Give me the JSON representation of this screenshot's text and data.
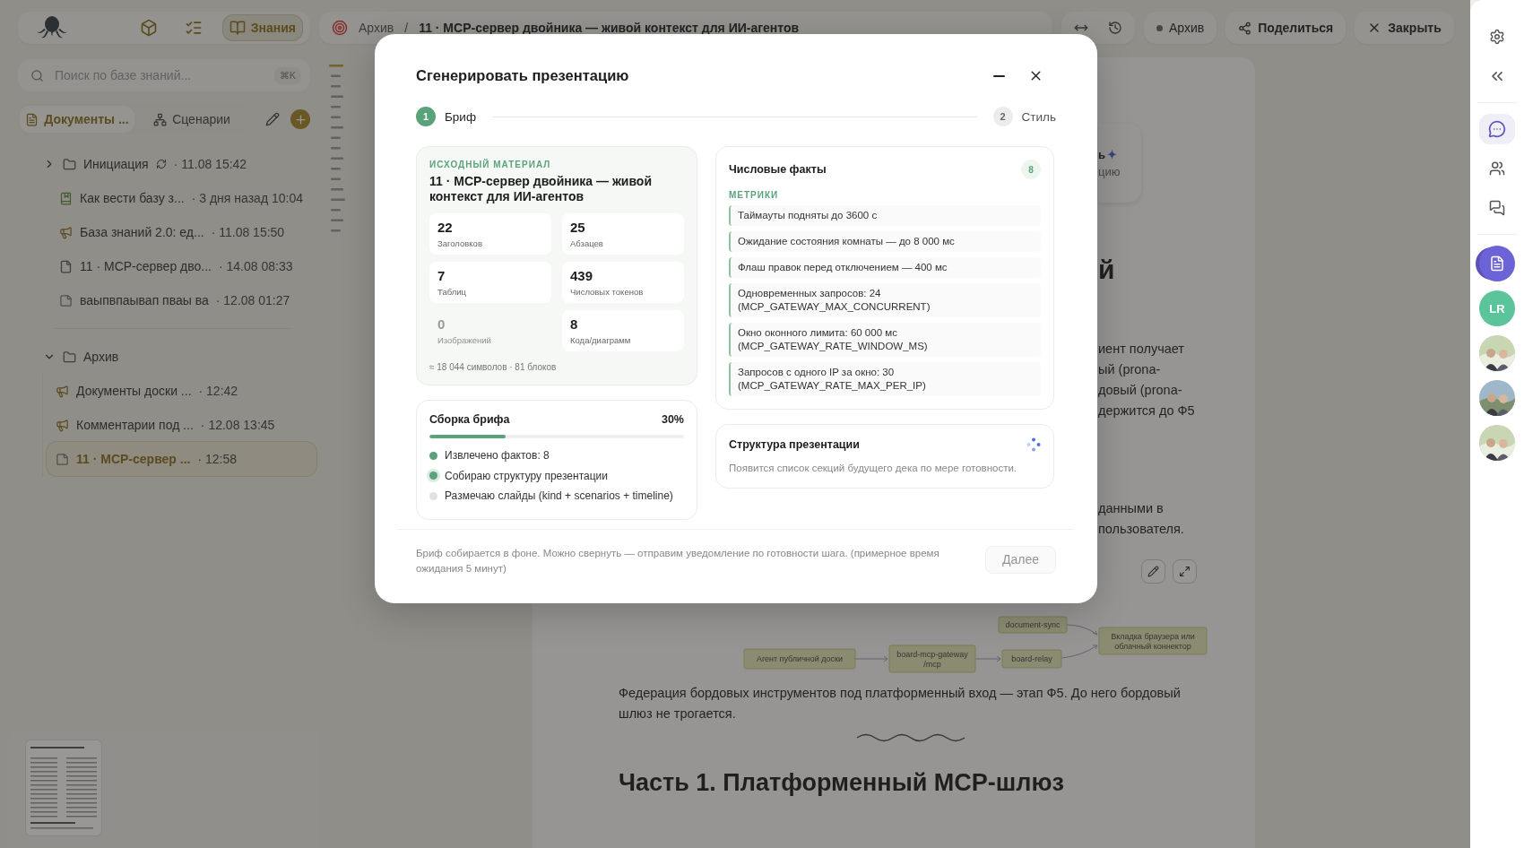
{
  "topbar": {
    "nav": [
      {
        "kind": "cube",
        "selected": false
      },
      {
        "kind": "checklist",
        "selected": false
      },
      {
        "kind": "book",
        "label": "Знания",
        "selected": true
      }
    ],
    "breadcrumb": {
      "parent": "Архив",
      "separator": "/",
      "current": "11 · MCP-сервер двойника — живой контекст для ИИ-агентов"
    },
    "status_button": {
      "label": "Архив"
    },
    "share_button": {
      "label": "Поделиться"
    },
    "close_button": {
      "label": "Закрыть"
    }
  },
  "sidebar": {
    "search": {
      "placeholder": "Поиск по базе знаний...",
      "shortcut": "⌘K"
    },
    "tabs": [
      {
        "kind": "page",
        "label": "Документы ...",
        "selected": true
      },
      {
        "kind": "flow",
        "label": "Сценарии",
        "selected": false
      }
    ],
    "tree_groups": [
      {
        "items": [
          {
            "kind": "folder",
            "title": "Инициация",
            "meta": "· 11.08 15:42",
            "expanded": false,
            "syncing": true,
            "selected": false
          },
          {
            "kind": "book",
            "title": "Как вести базу з...",
            "meta": "· 3 дня назад 10:04",
            "selected": false
          },
          {
            "kind": "megaphone",
            "title": "База знаний 2.0: ед...",
            "meta": "· 11.08 15:50",
            "selected": false
          },
          {
            "kind": "page",
            "title": "11 · MCP-сервер дво...",
            "meta": "· 14.08 08:33",
            "selected": false
          },
          {
            "kind": "board",
            "title": "ваыпвпаывап пваы ва",
            "meta": "· 12.08 01:27",
            "selected": false
          }
        ]
      },
      {
        "items": [
          {
            "kind": "folder",
            "title": "Архив",
            "expanded": true,
            "syncing": false,
            "selected": false,
            "children": [
              {
                "kind": "megaphone",
                "title": "Документы доски ...",
                "meta": "· 12:42",
                "selected": false
              },
              {
                "kind": "megaphone",
                "title": "Комментарии под ...",
                "meta": "· 12.08 13:45",
                "selected": false
              },
              {
                "kind": "board",
                "title": "11 · MCP-сервер ...",
                "meta": "· 12:58",
                "selected": true
              }
            ]
          }
        ]
      }
    ]
  },
  "document": {
    "card_fragment": [
      "ь",
      "цию"
    ],
    "card_sparkle": "✦",
    "heading_fragment": "й",
    "paragraph_fragment": [
      "иент получает",
      "ый (prona-",
      "довый (prona-",
      "держится до Ф5"
    ],
    "paragraph2_fragment": [
      "данными в",
      "пользователя."
    ],
    "diagram": {
      "nodes": [
        {
          "label": "document-sync"
        },
        {
          "label": "Вкладка браузера или облачный коннектор"
        },
        {
          "label": "Агент публичной доски"
        },
        {
          "label": "board-mcp-gateway /mcp"
        },
        {
          "label": "board-relay"
        }
      ]
    },
    "paragraph": "Федерация бордовых инструментов под платформенный вход — этап Ф5. До него бордовый шлюз не трогается.",
    "heading": "Часть 1. Платформенный MCP-шлюз"
  },
  "modal": {
    "title": "Сгенерировать презентацию",
    "steps": [
      {
        "number": "1",
        "label": "Бриф",
        "selected": true
      },
      {
        "number": "2",
        "label": "Стиль",
        "selected": false
      }
    ],
    "source": {
      "eyebrow": "ИСХОДНЫЙ МАТЕРИАЛ",
      "title": "11 · MCP-сервер двойника — живой контекст для ИИ-агентов",
      "stats": [
        {
          "value": "22",
          "label": "Заголовков",
          "disabled": false
        },
        {
          "value": "25",
          "label": "Абзацев",
          "disabled": false
        },
        {
          "value": "7",
          "label": "Таблиц",
          "disabled": false
        },
        {
          "value": "439",
          "label": "Числовых токенов",
          "disabled": false
        },
        {
          "value": "0",
          "label": "Изображений",
          "disabled": true
        },
        {
          "value": "8",
          "label": "Кода/диаграмм",
          "disabled": false
        }
      ],
      "summary": "≈ 18 044 символов · 81 блоков"
    },
    "progress": {
      "title": "Сборка брифа",
      "percent": "30%",
      "level": 0.3,
      "steps": [
        {
          "label": "Извлечено фактов: 8",
          "done": true,
          "active": false
        },
        {
          "label": "Собираю структуру презентации",
          "done": false,
          "active": true
        },
        {
          "label": "Размечаю слайды (kind + scenarios + timeline)",
          "done": false,
          "active": false
        }
      ]
    },
    "facts": {
      "title": "Числовые факты",
      "count": "8",
      "section": "МЕТРИКИ",
      "items": [
        "Таймауты подняты до 3600 с",
        "Ожидание состояния комнаты — до 8 000 мс",
        "Флаш правок перед отключением — 400 мс",
        "Одновременных запросов: 24 (MCP_GATEWAY_MAX_CONCURRENT)",
        "Окно оконного лимита: 60 000 мс (MCP_GATEWAY_RATE_WINDOW_MS)",
        "Запросов с одного IP за окно: 30 (MCP_GATEWAY_RATE_MAX_PER_IP)"
      ]
    },
    "structure": {
      "title": "Структура презентации",
      "text": "Появится список секций будущего дека по мере готовности."
    },
    "note": "Бриф собирается в фоне. Можно свернуть — отправим уведомление по готовности шага. (примерное время ожидания 5 минут)",
    "next_button": {
      "label": "Далее",
      "disabled": true
    }
  },
  "rail": {
    "tools": [
      {
        "kind": "chat",
        "selected": true
      },
      {
        "kind": "people",
        "selected": false
      },
      {
        "kind": "comments",
        "selected": false
      }
    ],
    "avatars": [
      {
        "kind": "document",
        "selected": true
      },
      {
        "kind": "initials",
        "initials": "LR",
        "selected": false
      },
      {
        "kind": "picture",
        "selected": false
      },
      {
        "kind": "picture",
        "selected": false
      },
      {
        "kind": "picture",
        "selected": false
      }
    ]
  }
}
